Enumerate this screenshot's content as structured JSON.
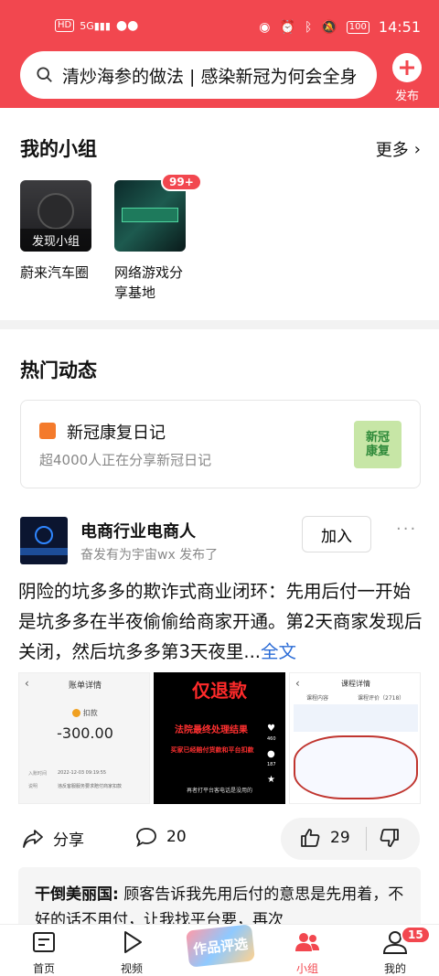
{
  "status_bar": {
    "left_indicators": [
      "HD",
      "5G",
      "wechat"
    ],
    "battery": "100",
    "time": "14:51"
  },
  "search": {
    "text": "清炒海参的做法 | 感染新冠为何会全身"
  },
  "publish": {
    "label": "发布"
  },
  "my_groups": {
    "title": "我的小组",
    "more_label": "更多",
    "groups": [
      {
        "name": "蔚来汽车圈",
        "thumb_caption": "发现小组"
      },
      {
        "name": "网络游戏分享基地",
        "badge": "99+"
      }
    ]
  },
  "hot": {
    "title": "热门动态",
    "card": {
      "title": "新冠康复日记",
      "subtitle": "超4000人正在分享新冠日记",
      "thumb_text": [
        "新冠",
        "康复"
      ]
    }
  },
  "post": {
    "author": "电商行业电商人",
    "meta": "奋发有为宇宙wx 发布了",
    "join_label": "加入",
    "more_label": "···",
    "text": "阴险的坑多多的欺诈式商业闭环：先用后付一开始是坑多多在半夜偷偷给商家开通。第2天商家发现后关闭，然后坑多多第3天夜里...",
    "fulltext_label": "全文",
    "image1": {
      "title": "账单详情",
      "tag": "扣款",
      "amount": "-300.00",
      "row1_label": "入账时间",
      "row1_value": "2022-12-03 09:19:55",
      "row2_label": "说明",
      "row2_value": "违反客服服务要求赔付商家扣款"
    },
    "image2": {
      "headline": "仅退款",
      "line1": "法院最终处理结果",
      "line2": "买家已经赔付货款和平台扣款",
      "line3": "再者打平台客电话是没用的",
      "likes": "460",
      "comments": "187"
    },
    "image3": {
      "title": "课程详情",
      "tab1": "课程内容",
      "tab2": "课程评价（2718）"
    },
    "share_label": "分享",
    "comment_count": "20",
    "like_count": "29"
  },
  "top_comment": {
    "author": "干倒美丽国:",
    "text": "顾客告诉我先用后付的意思是先用着，不好的话不用付，让我找平台要，再次"
  },
  "nav": {
    "items": [
      {
        "label": "首页"
      },
      {
        "label": "视频"
      },
      {
        "label": "作品评选"
      },
      {
        "label": "小组"
      },
      {
        "label": "我的"
      }
    ],
    "me_badge": "15"
  },
  "colors": {
    "accent": "#f2474f",
    "link": "#2a6bd6"
  }
}
